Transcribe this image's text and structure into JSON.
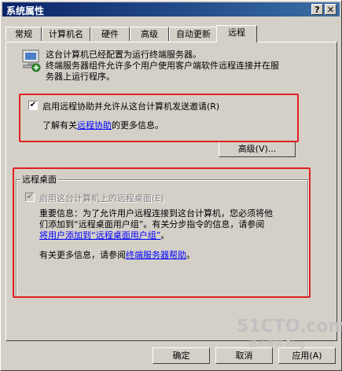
{
  "window": {
    "title": "系统属性",
    "help_label": "?",
    "close_label": "✕"
  },
  "tabs": [
    {
      "label": "常规"
    },
    {
      "label": "计算机名"
    },
    {
      "label": "硬件"
    },
    {
      "label": "高级"
    },
    {
      "label": "自动更新"
    },
    {
      "label": "远程"
    }
  ],
  "remote": {
    "intro_line1": "这台计算机已经配置为运行终端服务器。",
    "intro_line2": "终端服务器组件允许多个用户使用客户端软件远程连接并在服",
    "intro_line3": "务器上运行程序。",
    "assistance": {
      "checkbox_label": "启用远程协助并允许从这台计算机发送邀请",
      "checkbox_accel": "(R)",
      "checked": true,
      "more_prefix": "了解有关",
      "more_link": "远程协助",
      "more_suffix": "的更多信息。",
      "advanced_button": "高级(V)..."
    },
    "desktop": {
      "group_title": "远程桌面",
      "checkbox_label": "启用这台计算机上的远程桌面",
      "checkbox_accel": "(E)",
      "checked": true,
      "disabled": true,
      "important_line1": "重要信息：为了允许用户远程连接到这台计算机，您必须将他",
      "important_line2": "们添加到“远程桌面用户组”。有关分步指令的信息，请参阅",
      "important_link": "将用户添加到“远程桌面用户组”",
      "important_end": "。",
      "help_prefix": "有关更多信息，请参阅",
      "help_link": "终端服务器帮助",
      "help_suffix": "。"
    }
  },
  "buttons": {
    "ok": "确定",
    "cancel": "取消",
    "apply": "应用(A)"
  },
  "watermark": {
    "site": "51CTO.com",
    "sub": "技术博客 Blog"
  }
}
